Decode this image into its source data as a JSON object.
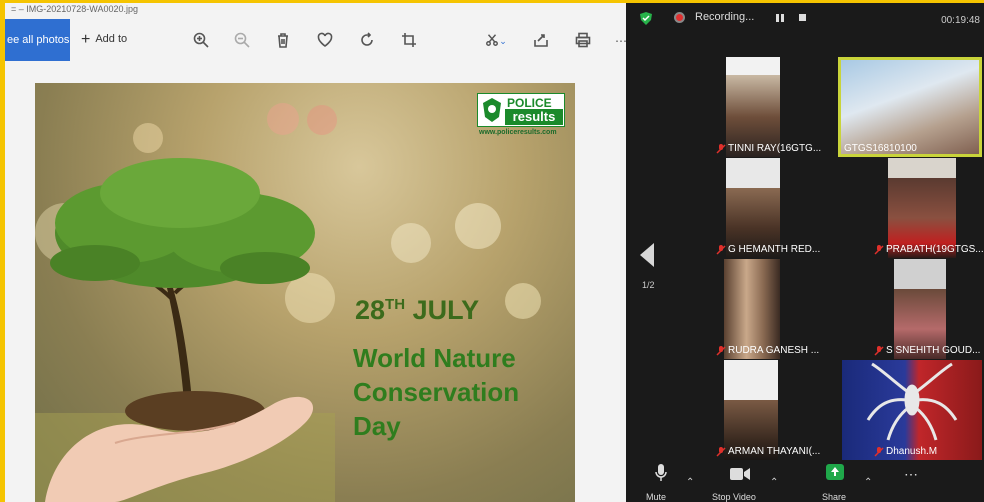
{
  "photos_app": {
    "filename": "= – IMG-20210728-WA0020.jpg",
    "toolbar": {
      "see_all_label": "ee all photos",
      "add_to_label": "Add to",
      "icons": [
        "zoom-in-icon",
        "zoom-out-icon",
        "delete-icon",
        "heart-icon",
        "rotate-icon",
        "crop-icon",
        "edit-icon",
        "share-icon",
        "print-icon",
        "more-icon"
      ]
    },
    "poster": {
      "logo_line1": "POLICE",
      "logo_line2": "results",
      "logo_url": "www.policeresults.com",
      "date_day": "28",
      "date_sup": "TH",
      "date_month": "JULY",
      "title_line1": "World Nature",
      "title_line2": "Conservation",
      "title_line3": "Day"
    }
  },
  "zoom": {
    "recording_label": "Recording...",
    "timer": "00:19:48",
    "page_indicator": "1/2",
    "participants": [
      {
        "name": "TINNI  RAY(16GTG...",
        "muted": true
      },
      {
        "name": "GTGS16810100",
        "muted": false
      },
      {
        "name": "G HEMANTH RED...",
        "muted": true
      },
      {
        "name": "PRABATH(19GTGS...",
        "muted": true
      },
      {
        "name": "RUDRA GANESH ...",
        "muted": true
      },
      {
        "name": "S SNEHITH GOUD...",
        "muted": true
      },
      {
        "name": "ARMAN THAYANI(...",
        "muted": true
      },
      {
        "name": "Dhanush.M",
        "muted": true
      }
    ],
    "bottom_bar": {
      "mute_label": "Mute",
      "video_label": "Stop Video",
      "share_label": "Share"
    },
    "colors": {
      "active_speaker": "#c9d43a",
      "muted_mic": "#e0302b",
      "share_button": "#1fa84a"
    }
  }
}
